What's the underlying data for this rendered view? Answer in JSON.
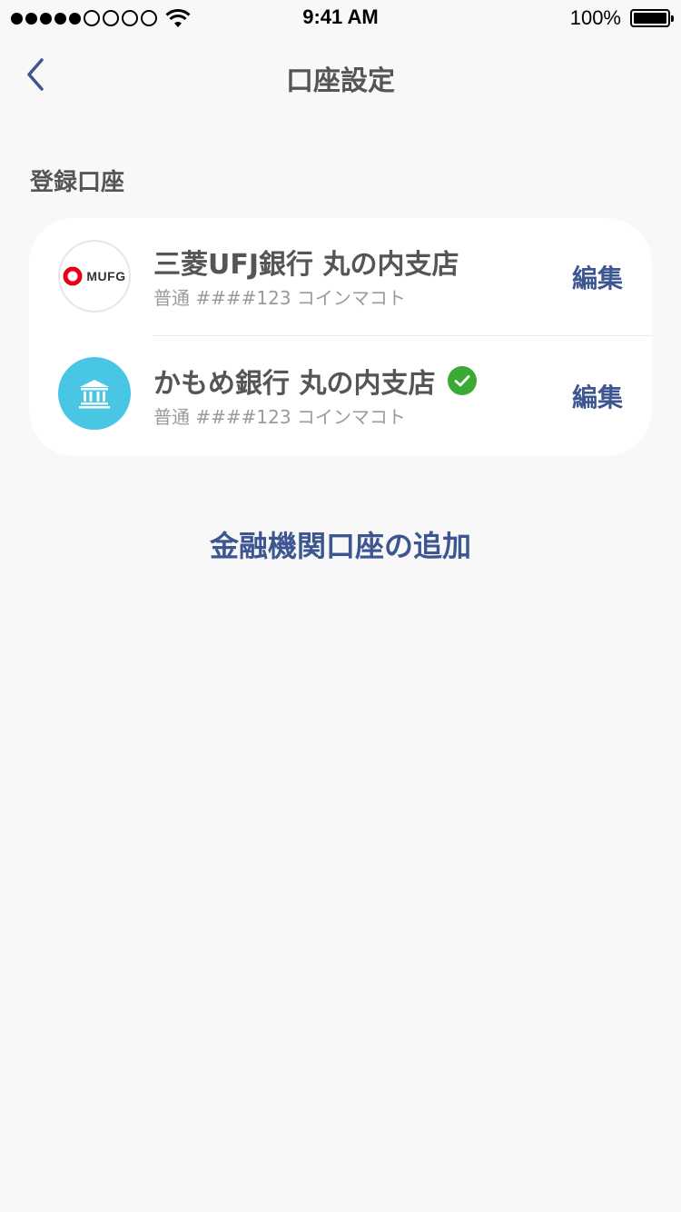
{
  "status_bar": {
    "time": "9:41 AM",
    "battery_percent": "100%",
    "signal_filled": 5,
    "signal_empty": 4
  },
  "nav": {
    "title": "口座設定",
    "back_icon": "chevron-left-icon"
  },
  "section": {
    "label": "登録口座"
  },
  "accounts": [
    {
      "bank_name": "三菱UFJ銀行 丸の内支店",
      "detail": "普通 ####123 コインマコト",
      "logo_text": "MUFG",
      "logo_icon": "mufg-logo-icon",
      "verified": false,
      "edit_label": "編集"
    },
    {
      "bank_name": "かもめ銀行 丸の内支店",
      "detail": "普通 ####123 コインマコト",
      "logo_icon": "bank-building-icon",
      "verified": true,
      "verified_icon": "check-circle-icon",
      "edit_label": "編集"
    }
  ],
  "actions": {
    "add_account": "金融機関口座の追加"
  },
  "colors": {
    "background": "#f8f8f8",
    "card": "#ffffff",
    "primary_text": "#555555",
    "secondary_text": "#9a9a9a",
    "accent": "#3d5591",
    "bank_logo_bg": "#48c6e3",
    "verified_green": "#3aaa35",
    "mufg_red": "#e60012"
  }
}
